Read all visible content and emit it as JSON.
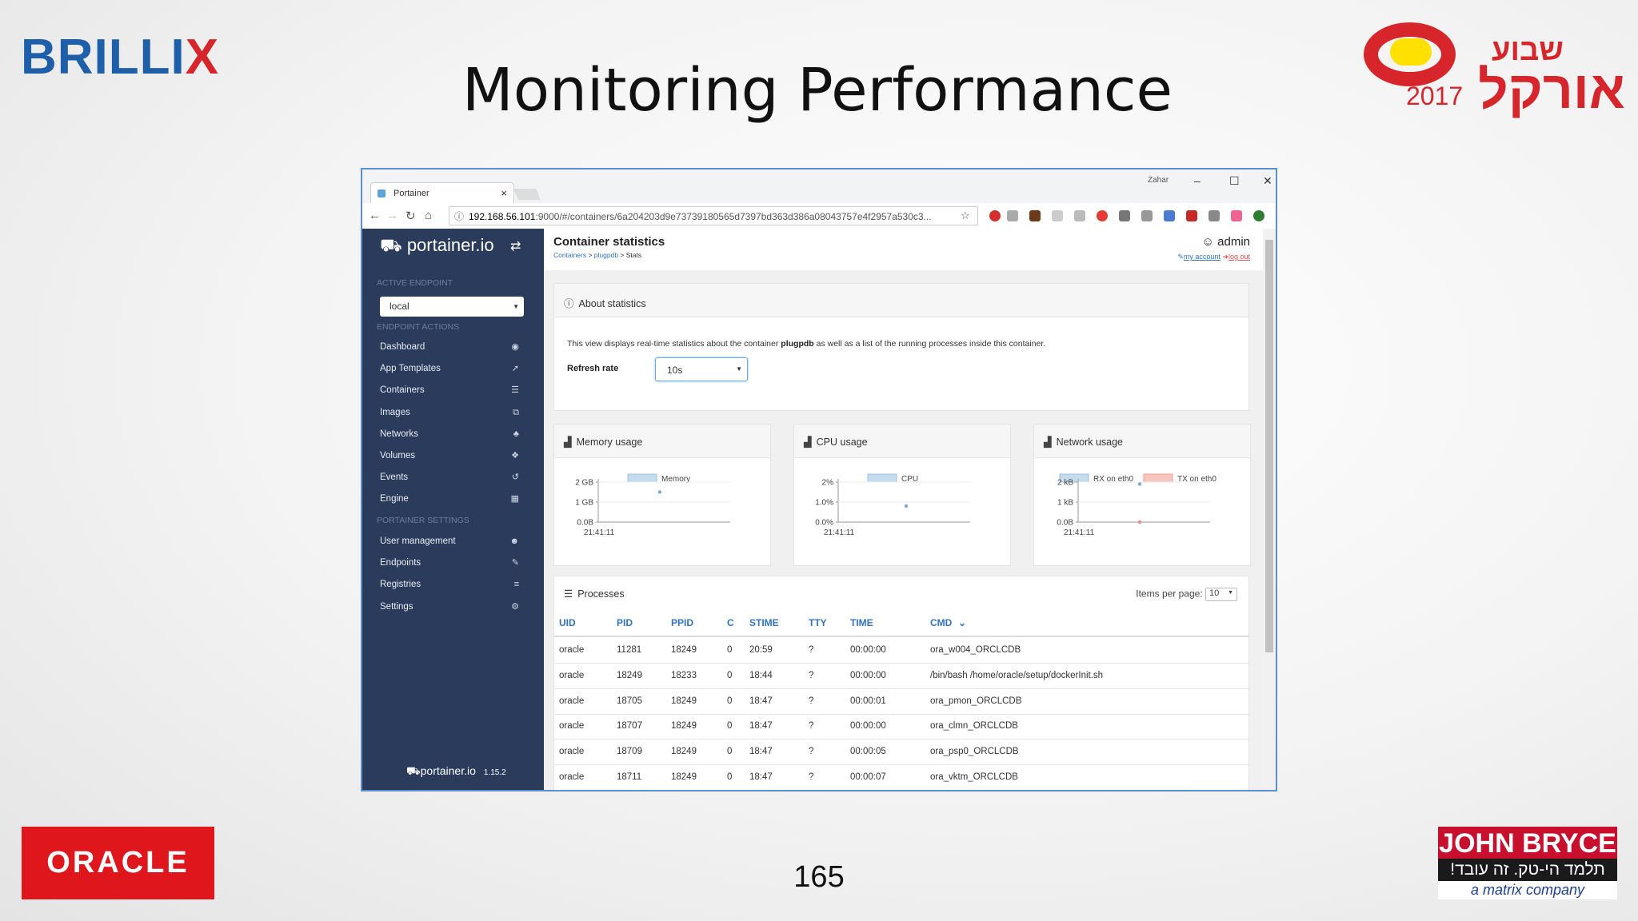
{
  "slide": {
    "title": "Monitoring Performance",
    "page_number": "165",
    "brillix_main": "BRILLI",
    "brillix_x": "X",
    "oracle_logo": "ORACLE",
    "oracle_week_year": "2017",
    "oracle_week_he1": "שבוע",
    "oracle_week_he2": "אורקל",
    "john_bryce": "JOHN BRYCE",
    "john_bryce_he": "תלמד הי-טק. זה עובד!",
    "john_bryce_matrix": "a matrix company"
  },
  "browser": {
    "tab_title": "Portainer",
    "tab_close": "×",
    "window_user": "Zahar",
    "url_host": "192.168.56.101",
    "url_path": ":9000/#/containers/6a204203d9e73739180565d7397bd363d386a08043757e4f2957a530c3..."
  },
  "portainer": {
    "logo": "portainer.io",
    "active_endpoint_label": "ACTIVE ENDPOINT",
    "endpoint_value": "local",
    "endpoint_actions_label": "ENDPOINT ACTIONS",
    "nav": [
      {
        "label": "Dashboard",
        "icon": "dashboard-icon",
        "glyph": "◉"
      },
      {
        "label": "App Templates",
        "icon": "rocket-icon",
        "glyph": "➚"
      },
      {
        "label": "Containers",
        "icon": "list-icon",
        "glyph": "☰"
      },
      {
        "label": "Images",
        "icon": "clone-icon",
        "glyph": "⧉"
      },
      {
        "label": "Networks",
        "icon": "sitemap-icon",
        "glyph": "♣"
      },
      {
        "label": "Volumes",
        "icon": "cubes-icon",
        "glyph": "❖"
      },
      {
        "label": "Events",
        "icon": "history-icon",
        "glyph": "↺"
      },
      {
        "label": "Engine",
        "icon": "th-icon",
        "glyph": "▦"
      }
    ],
    "settings_label": "PORTAINER SETTINGS",
    "settings_nav": [
      {
        "label": "User management",
        "icon": "users-icon",
        "glyph": "☻"
      },
      {
        "label": "Endpoints",
        "icon": "plug-icon",
        "glyph": "✎"
      },
      {
        "label": "Registries",
        "icon": "database-icon",
        "glyph": "≡"
      },
      {
        "label": "Settings",
        "icon": "cogs-icon",
        "glyph": "⚙"
      }
    ],
    "footer_logo": "portainer.io",
    "version": "1.15.2",
    "page_title": "Container statistics",
    "breadcrumb_containers": "Containers",
    "breadcrumb_sep1": " > ",
    "breadcrumb_container": "plugpdb",
    "breadcrumb_sep2": " > ",
    "breadcrumb_current": "Stats",
    "user": "admin",
    "my_account": "my account",
    "log_out": "log out",
    "about_title": "About statistics",
    "about_text_pre": "This view displays real-time statistics about the container ",
    "about_text_bold": "plugpdb",
    "about_text_post": " as well as a list of the running processes inside this container.",
    "refresh_label": "Refresh rate",
    "refresh_value": "10s",
    "memory_title": "Memory usage",
    "cpu_title": "CPU usage",
    "network_title": "Network usage",
    "processes_title": "Processes",
    "items_per_page_label": "Items per page:",
    "items_per_page_value": "10",
    "columns": [
      "UID",
      "PID",
      "PPID",
      "C",
      "STIME",
      "TTY",
      "TIME",
      "CMD"
    ],
    "rows": [
      [
        "oracle",
        "11281",
        "18249",
        "0",
        "20:59",
        "?",
        "00:00:00",
        "ora_w004_ORCLCDB"
      ],
      [
        "oracle",
        "18249",
        "18233",
        "0",
        "18:44",
        "?",
        "00:00:00",
        "/bin/bash /home/oracle/setup/dockerInit.sh"
      ],
      [
        "oracle",
        "18705",
        "18249",
        "0",
        "18:47",
        "?",
        "00:00:01",
        "ora_pmon_ORCLCDB"
      ],
      [
        "oracle",
        "18707",
        "18249",
        "0",
        "18:47",
        "?",
        "00:00:00",
        "ora_clmn_ORCLCDB"
      ],
      [
        "oracle",
        "18709",
        "18249",
        "0",
        "18:47",
        "?",
        "00:00:05",
        "ora_psp0_ORCLCDB"
      ],
      [
        "oracle",
        "18711",
        "18249",
        "0",
        "18:47",
        "?",
        "00:00:07",
        "ora_vktm_ORCLCDB"
      ]
    ]
  },
  "chart_data": [
    {
      "type": "line",
      "title": "Memory usage",
      "series": [
        {
          "name": "Memory",
          "x": [
            "21:41:11"
          ],
          "values": [
            1.5
          ],
          "color": "#c5dced"
        }
      ],
      "y_ticks": [
        "2 GB",
        "1 GB",
        "0.0B"
      ],
      "x_ticks": [
        "21:41:11"
      ],
      "ylim": [
        0,
        2
      ]
    },
    {
      "type": "line",
      "title": "CPU usage",
      "series": [
        {
          "name": "CPU",
          "x": [
            "21:41:11"
          ],
          "values": [
            0.8
          ],
          "color": "#c5dced"
        }
      ],
      "y_ticks": [
        "2%",
        "1.0%",
        "0.0%"
      ],
      "x_ticks": [
        "21:41:11"
      ],
      "ylim": [
        0,
        2
      ]
    },
    {
      "type": "line",
      "title": "Network usage",
      "series": [
        {
          "name": "RX on eth0",
          "x": [
            "21:41:11"
          ],
          "values": [
            1.9
          ],
          "color": "#c5dced"
        },
        {
          "name": "TX on eth0",
          "x": [
            "21:41:11"
          ],
          "values": [
            0.0
          ],
          "color": "#f7c6c0"
        }
      ],
      "y_ticks": [
        "2 kB",
        "1 kB",
        "0.0B"
      ],
      "x_ticks": [
        "21:41:11"
      ],
      "ylim": [
        0,
        2
      ]
    }
  ]
}
